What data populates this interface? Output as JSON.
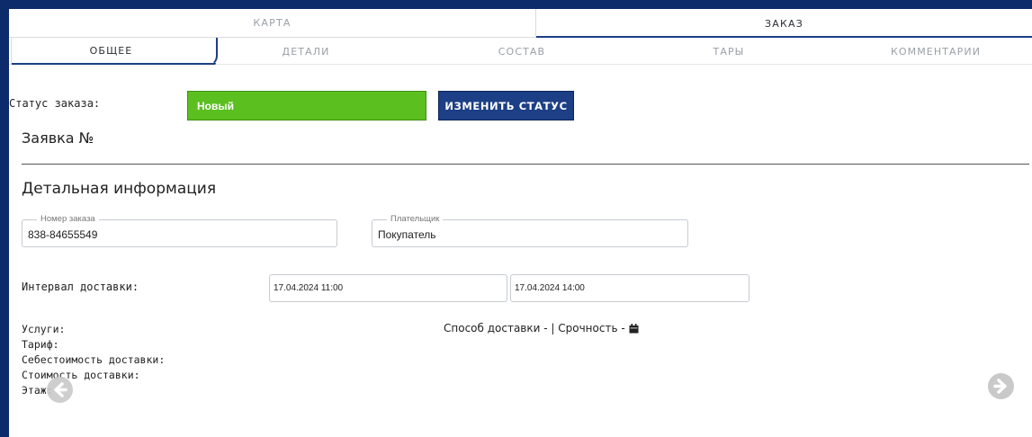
{
  "top_tabs": [
    {
      "label": "КАРТА",
      "active": false
    },
    {
      "label": "ЗАКАЗ",
      "active": true
    }
  ],
  "sub_tabs": [
    {
      "label": "ОБЩЕЕ",
      "active": true
    },
    {
      "label": "ДЕТАЛИ",
      "active": false
    },
    {
      "label": "СОСТАВ",
      "active": false
    },
    {
      "label": "ТАРЫ",
      "active": false
    },
    {
      "label": "КОММЕНТАРИИ",
      "active": false
    }
  ],
  "status": {
    "label": "Статус заказа:",
    "value": "Новый",
    "change_button": "ИЗМЕНИТЬ СТАТУС"
  },
  "order": {
    "title": "Заявка №",
    "section_title": "Детальная информация",
    "order_number": {
      "legend": "Номер заказа",
      "value": "838-84655549"
    },
    "payer": {
      "legend": "Плательщик",
      "value": "Покупатель"
    }
  },
  "delivery_interval": {
    "label": "Интервал доставки:",
    "from": "17.04.2024 11:00",
    "to": "17.04.2024 14:00"
  },
  "info": {
    "services": "Услуги:",
    "tariff": "Тариф:",
    "cost_price": "Себестоимость доставки:",
    "delivery_cost": "Стоимость доставки:",
    "floor": "Этаж:"
  },
  "delivery_method": {
    "text": "Способ доставки - | Срочность -"
  },
  "colors": {
    "frame": "#0d2a6b",
    "accent": "#1c3f86",
    "status_new": "#5bbf1f",
    "arrow": "#c9c9c9"
  },
  "icons": {
    "calendar": "calendar-icon",
    "prev": "arrow-left-circle-icon",
    "next": "arrow-right-circle-icon"
  }
}
